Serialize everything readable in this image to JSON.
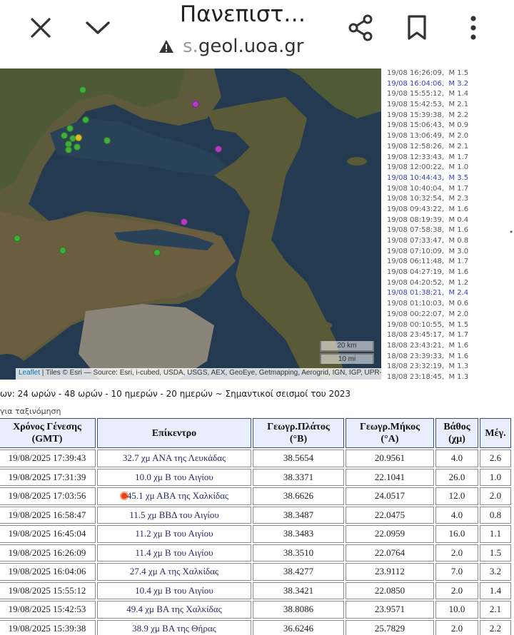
{
  "browser": {
    "title": "Πανεπιστ…",
    "url_domain_faded": "s.",
    "url_domain": "geol.uoa.gr",
    "icons": [
      "close-icon",
      "chevron-down-icon",
      "warning-icon",
      "share-icon",
      "bookmark-icon",
      "more-vert-icon"
    ]
  },
  "map": {
    "scale_km": "20 km",
    "scale_mi": "10 mi",
    "attribution_link": "Leaflet",
    "attribution_text": " | Tiles © Esri — Source: Esri, i-cubed, USDA, USGS, AEX, GeoEye, Getmapping, Aerogrid, IGN, IGP, UPR-EGP",
    "quake_colors": {
      "green": "#3fae3a",
      "magenta": "#b23cc0",
      "yellow": "#d8c22a"
    }
  },
  "event_list": [
    {
      "text": "19/08 16:26:09,  M 1.5",
      "highlight": false
    },
    {
      "text": "19/08 16:04:06,  M 3.2",
      "highlight": true
    },
    {
      "text": "19/08 15:55:12,  M 1.4",
      "highlight": false
    },
    {
      "text": "19/08 15:42:53,  M 2.1",
      "highlight": false
    },
    {
      "text": "19/08 15:39:38,  M 2.2",
      "highlight": false
    },
    {
      "text": "19/08 15:06:43,  M 0.9",
      "highlight": false
    },
    {
      "text": "19/08 13:06:49,  M 2.0",
      "highlight": false
    },
    {
      "text": "19/08 12:58:26,  M 2.1",
      "highlight": false
    },
    {
      "text": "19/08 12:33:43,  M 1.7",
      "highlight": false
    },
    {
      "text": "19/08 12:00:22,  M 1.0",
      "highlight": false
    },
    {
      "text": "19/08 10:44:43,  M 3.5",
      "highlight": true
    },
    {
      "text": "19/08 10:40:04,  M 1.7",
      "highlight": false
    },
    {
      "text": "19/08 10:32:54,  M 2.3",
      "highlight": false
    },
    {
      "text": "19/08 09:43:22,  M 1.6",
      "highlight": false
    },
    {
      "text": "19/08 08:19:39,  M 0.4",
      "highlight": false
    },
    {
      "text": "19/08 07:58:38,  M 1.6",
      "highlight": false
    },
    {
      "text": "19/08 07:33:47,  M 0.8",
      "highlight": false
    },
    {
      "text": "19/08 07:10:09,  M 3.0",
      "highlight": false
    },
    {
      "text": "19/08 06:11:48,  M 1.7",
      "highlight": false
    },
    {
      "text": "19/08 04:27:19,  M 1.6",
      "highlight": false
    },
    {
      "text": "19/08 04:20:52,  M 1.2",
      "highlight": false
    },
    {
      "text": "19/08 01:38:21,  M 2.4",
      "highlight": true
    },
    {
      "text": "19/08 01:10:03,  M 0.6",
      "highlight": false
    },
    {
      "text": "19/08 00:22:07,  M 2.0",
      "highlight": false
    },
    {
      "text": "19/08 00:10:55,  M 1.5",
      "highlight": false
    },
    {
      "text": "18/08 23:45:17,  M 1.7",
      "highlight": false
    },
    {
      "text": "18/08 23:43:21,  M 1.6",
      "highlight": false
    },
    {
      "text": "18/08 23:39:33,  M 1.6",
      "highlight": false
    },
    {
      "text": "18/08 23:32:19,  M 1.3",
      "highlight": false
    },
    {
      "text": "18/08 23:18:45,  M 1.3",
      "highlight": false
    }
  ],
  "edge_mark": "•",
  "time_links": "ων: 24 ωρών - 48 ωρών - 10 ημερών - 20 ημερών ~ Σημαντικοί σεισμοί του 2023",
  "sort_link": "για ταξινόμηση",
  "table": {
    "headers": [
      "Χρόνος Γένεσης\n(GMT)",
      "Επίκεντρο",
      "Γεωγρ.Πλάτος\n(°B)",
      "Γεωγρ.Μήκος\n(°A)",
      "Βάθος\n(χμ)",
      "Μέγ."
    ],
    "rows": [
      {
        "time": "19/08/2025 17:39:43",
        "epicenter": "32.7 χμ ΑΝΑ της Λευκάδας",
        "lat": "38.5654",
        "lon": "20.9561",
        "depth": "4.0",
        "mag": "2.6",
        "flag": false
      },
      {
        "time": "19/08/2025 17:31:39",
        "epicenter": "10.0 χμ Β του Αιγίου",
        "lat": "38.3371",
        "lon": "22.1041",
        "depth": "26.0",
        "mag": "1.0",
        "flag": false
      },
      {
        "time": "19/08/2025 17:03:56",
        "epicenter": "45.1 χμ ΑΒΑ της Χαλκίδας",
        "lat": "38.6626",
        "lon": "24.0517",
        "depth": "12.0",
        "mag": "2.0",
        "flag": true
      },
      {
        "time": "19/08/2025 16:58:47",
        "epicenter": "11.5 χμ ΒΒΔ του Αιγίου",
        "lat": "38.3487",
        "lon": "22.0475",
        "depth": "4.0",
        "mag": "0.8",
        "flag": false
      },
      {
        "time": "19/08/2025 16:45:04",
        "epicenter": "11.2 χμ Β του Αιγίου",
        "lat": "38.3483",
        "lon": "22.0959",
        "depth": "16.0",
        "mag": "1.1",
        "flag": false
      },
      {
        "time": "19/08/2025 16:26:09",
        "epicenter": "11.4 χμ Β του Αιγίου",
        "lat": "38.3510",
        "lon": "22.0764",
        "depth": "2.0",
        "mag": "1.5",
        "flag": false
      },
      {
        "time": "19/08/2025 16:04:06",
        "epicenter": "27.4 χμ Α της Χαλκίδας",
        "lat": "38.4277",
        "lon": "23.9112",
        "depth": "7.0",
        "mag": "3.2",
        "flag": false
      },
      {
        "time": "19/08/2025 15:55:12",
        "epicenter": "10.4 χμ Β του Αιγίου",
        "lat": "38.3421",
        "lon": "22.0850",
        "depth": "2.0",
        "mag": "1.4",
        "flag": false
      },
      {
        "time": "19/08/2025 15:42:53",
        "epicenter": "49.4 χμ ΒΑ της Χαλκίδας",
        "lat": "38.8086",
        "lon": "23.9571",
        "depth": "10.0",
        "mag": "2.1",
        "flag": false
      },
      {
        "time": "19/08/2025 15:39:38",
        "epicenter": "38.9 χμ ΒΑ της Θήρας",
        "lat": "36.6246",
        "lon": "25.7829",
        "depth": "2.0",
        "mag": "2.2",
        "flag": false
      }
    ]
  }
}
